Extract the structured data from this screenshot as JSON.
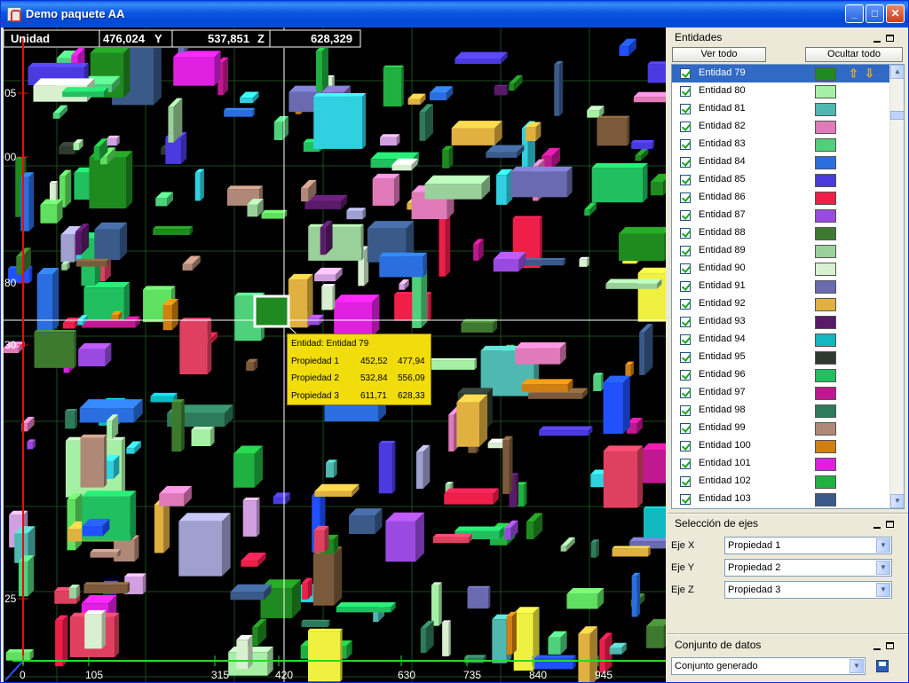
{
  "window": {
    "title": "Demo paquete AA"
  },
  "coords": {
    "x_label": "Unidad",
    "x_value": "476,024",
    "y_label": "Y",
    "y_value": "537,851",
    "z_label": "Z",
    "z_value": "628,329"
  },
  "axis_ticks": {
    "bottom": [
      "0",
      "105",
      "315",
      "420",
      "630",
      "735",
      "840",
      "945"
    ],
    "left": [
      "05",
      "00",
      "80",
      "30",
      "25",
      "05"
    ]
  },
  "tooltip": {
    "title": "Entidad: Entidad 79",
    "rows": [
      {
        "name": "Propiedad 1",
        "v1": "452,52",
        "v2": "477,94"
      },
      {
        "name": "Propiedad 2",
        "v1": "532,84",
        "v2": "556,09"
      },
      {
        "name": "Propiedad 3",
        "v1": "611,71",
        "v2": "628,33"
      }
    ]
  },
  "entities_panel": {
    "title": "Entidades",
    "show_all": "Ver todo",
    "hide_all": "Ocultar todo",
    "items": [
      {
        "label": "Entidad 79",
        "color": "#1f8a1f",
        "selected": true
      },
      {
        "label": "Entidad 80",
        "color": "#a6f0a6"
      },
      {
        "label": "Entidad 81",
        "color": "#4fb8b0"
      },
      {
        "label": "Entidad 82",
        "color": "#e07ab8"
      },
      {
        "label": "Entidad 83",
        "color": "#4fd07a"
      },
      {
        "label": "Entidad 84",
        "color": "#2a6ee0"
      },
      {
        "label": "Entidad 85",
        "color": "#4a3ae0"
      },
      {
        "label": "Entidad 86",
        "color": "#f01f4a"
      },
      {
        "label": "Entidad 87",
        "color": "#9a4ae0"
      },
      {
        "label": "Entidad 88",
        "color": "#3e7a2e"
      },
      {
        "label": "Entidad 89",
        "color": "#9ad09a"
      },
      {
        "label": "Entidad 90",
        "color": "#d8f0d0"
      },
      {
        "label": "Entidad 91",
        "color": "#6a6ab0"
      },
      {
        "label": "Entidad 92",
        "color": "#e0b040"
      },
      {
        "label": "Entidad 93",
        "color": "#5a1a6a"
      },
      {
        "label": "Entidad 94",
        "color": "#10b8c0"
      },
      {
        "label": "Entidad 95",
        "color": "#2e3a2e"
      },
      {
        "label": "Entidad 96",
        "color": "#20c060"
      },
      {
        "label": "Entidad 97",
        "color": "#c01890"
      },
      {
        "label": "Entidad 98",
        "color": "#2e7a5a"
      },
      {
        "label": "Entidad 99",
        "color": "#b08878"
      },
      {
        "label": "Entidad 100",
        "color": "#d08010"
      },
      {
        "label": "Entidad 101",
        "color": "#e020e0"
      },
      {
        "label": "Entidad 102",
        "color": "#20b040"
      },
      {
        "label": "Entidad 103",
        "color": "#3a5a8a"
      }
    ]
  },
  "axes_panel": {
    "title": "Selección de ejes",
    "x_label": "Eje X",
    "x_value": "Propiedad 1",
    "y_label": "Eje Y",
    "y_value": "Propiedad 2",
    "z_label": "Eje Z",
    "z_value": "Propiedad 3"
  },
  "dataset_panel": {
    "title": "Conjunto de datos",
    "value": "Conjunto generado"
  }
}
